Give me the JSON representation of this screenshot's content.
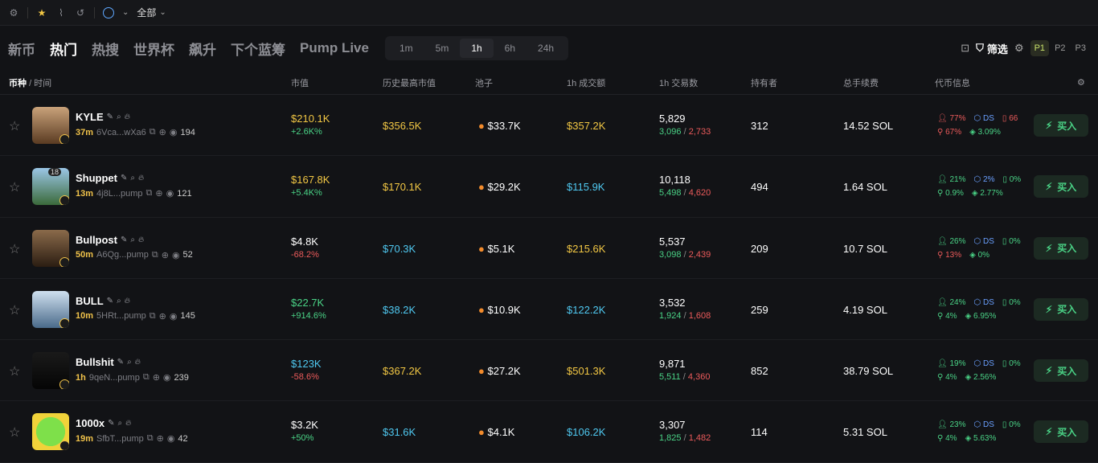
{
  "topbar": {
    "all_label": "全部"
  },
  "nav": {
    "tabs": [
      "新币",
      "热门",
      "热搜",
      "世界杯",
      "飙升",
      "下个蓝筹",
      "Pump Live"
    ],
    "active_tab": 1,
    "timeframes": [
      "1m",
      "5m",
      "1h",
      "6h",
      "24h"
    ],
    "active_timeframe": 2,
    "filter_label": "筛选",
    "pages": [
      "P1",
      "P2",
      "P3"
    ]
  },
  "headers": {
    "coin": "币种",
    "time": "/ 时间",
    "mcap": "市值",
    "ath": "历史最高市值",
    "pool": "池子",
    "vol": "1h 成交额",
    "txns": "1h 交易数",
    "holders": "持有者",
    "fees": "总手续费",
    "info": "代币信息"
  },
  "rows": [
    {
      "name": "KYLE",
      "age": "37m",
      "addr": "6Vca...wXa6",
      "views": "194",
      "mcap": "$210.1K",
      "mcap_chg": "+2.6K%",
      "mcap_color": "yellow",
      "chg_color": "green",
      "ath": "$356.5K",
      "ath_color": "yellow",
      "pool": "$33.7K",
      "vol": "$357.2K",
      "vol_color": "yellow",
      "txns": "5,829",
      "buys": "3,096",
      "sells": "2,733",
      "holders": "312",
      "fees": "14.52 SOL",
      "i1": "77%",
      "i1c": "rd",
      "i2": "DS",
      "i3": "66",
      "i3c": "rd",
      "i4": "67%",
      "i4c": "rd",
      "i5": "3.09%",
      "i5c": "g"
    },
    {
      "name": "Shuppet",
      "age": "13m",
      "addr": "4j8L...pump",
      "views": "121",
      "mcap": "$167.8K",
      "mcap_chg": "+5.4K%",
      "mcap_color": "yellow",
      "chg_color": "green",
      "ath": "$170.1K",
      "ath_color": "yellow",
      "pool": "$29.2K",
      "vol": "$115.9K",
      "vol_color": "cyan",
      "txns": "10,118",
      "buys": "5,498",
      "sells": "4,620",
      "holders": "494",
      "fees": "1.64 SOL",
      "i1": "21%",
      "i1c": "g",
      "i2": "2%",
      "i3": "0%",
      "i3c": "g",
      "i4": "0.9%",
      "i4c": "g",
      "i5": "2.77%",
      "i5c": "g",
      "badge": "18"
    },
    {
      "name": "Bullpost",
      "age": "50m",
      "addr": "A6Qg...pump",
      "views": "52",
      "mcap": "$4.8K",
      "mcap_chg": "-68.2%",
      "mcap_color": "white",
      "chg_color": "red",
      "ath": "$70.3K",
      "ath_color": "cyan",
      "pool": "$5.1K",
      "vol": "$215.6K",
      "vol_color": "yellow",
      "txns": "5,537",
      "buys": "3,098",
      "sells": "2,439",
      "holders": "209",
      "fees": "10.7 SOL",
      "i1": "26%",
      "i1c": "g",
      "i2": "DS",
      "i3": "0%",
      "i3c": "g",
      "i4": "13%",
      "i4c": "rd",
      "i5": "0%",
      "i5c": "g"
    },
    {
      "name": "BULL",
      "age": "10m",
      "addr": "5HRt...pump",
      "views": "145",
      "mcap": "$22.7K",
      "mcap_chg": "+914.6%",
      "mcap_color": "green",
      "chg_color": "green",
      "ath": "$38.2K",
      "ath_color": "cyan",
      "pool": "$10.9K",
      "vol": "$122.2K",
      "vol_color": "cyan",
      "txns": "3,532",
      "buys": "1,924",
      "sells": "1,608",
      "holders": "259",
      "fees": "4.19 SOL",
      "i1": "24%",
      "i1c": "g",
      "i2": "DS",
      "i3": "0%",
      "i3c": "g",
      "i4": "4%",
      "i4c": "g",
      "i5": "6.95%",
      "i5c": "g"
    },
    {
      "name": "Bullshit",
      "age": "1h",
      "addr": "9qeN...pump",
      "views": "239",
      "mcap": "$123K",
      "mcap_chg": "-58.6%",
      "mcap_color": "cyan",
      "chg_color": "red",
      "ath": "$367.2K",
      "ath_color": "yellow",
      "pool": "$27.2K",
      "vol": "$501.3K",
      "vol_color": "yellow",
      "txns": "9,871",
      "buys": "5,511",
      "sells": "4,360",
      "holders": "852",
      "fees": "38.79 SOL",
      "i1": "19%",
      "i1c": "g",
      "i2": "DS",
      "i3": "0%",
      "i3c": "g",
      "i4": "4%",
      "i4c": "g",
      "i5": "2.56%",
      "i5c": "g"
    },
    {
      "name": "1000x",
      "age": "19m",
      "addr": "SfbT...pump",
      "views": "42",
      "mcap": "$3.2K",
      "mcap_chg": "+50%",
      "mcap_color": "white",
      "chg_color": "green",
      "ath": "$31.6K",
      "ath_color": "cyan",
      "pool": "$4.1K",
      "vol": "$106.2K",
      "vol_color": "cyan",
      "txns": "3,307",
      "buys": "1,825",
      "sells": "1,482",
      "holders": "114",
      "fees": "5.31 SOL",
      "i1": "23%",
      "i1c": "g",
      "i2": "DS",
      "i3": "0%",
      "i3c": "g",
      "i4": "4%",
      "i4c": "g",
      "i5": "5.63%",
      "i5c": "g"
    }
  ],
  "buy_label": "买入",
  "colors": {
    "accent": "#4ad386",
    "yellow": "#f2c744",
    "red": "#ec5b5b",
    "cyan": "#4fc8f0"
  }
}
